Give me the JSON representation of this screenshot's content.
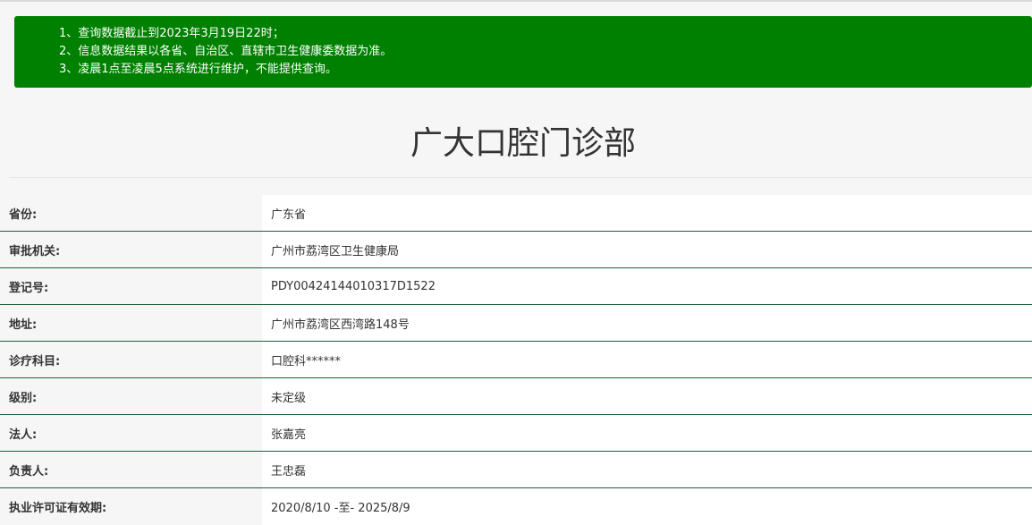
{
  "notice": {
    "lines": [
      "1、查询数据截止到2023年3月19日22时；",
      "2、信息数据结果以各省、自治区、直辖市卫生健康委数据为准。",
      "3、凌晨1点至凌晨5点系统进行维护，不能提供查询。"
    ],
    "background": "#008000"
  },
  "title": "广大口腔门诊部",
  "rows": [
    {
      "label": "省份:",
      "value": "广东省"
    },
    {
      "label": "审批机关:",
      "value": "广州市荔湾区卫生健康局"
    },
    {
      "label": "登记号:",
      "value": "PDY00424144010317D1522"
    },
    {
      "label": "地址:",
      "value": "广州市荔湾区西湾路148号"
    },
    {
      "label": "诊疗科目:",
      "value": "口腔科******"
    },
    {
      "label": "级别:",
      "value": "未定级"
    },
    {
      "label": "法人:",
      "value": "张嘉亮"
    },
    {
      "label": "负责人:",
      "value": "王忠磊"
    },
    {
      "label": "执业许可证有效期:",
      "value": "2020/8/10 -至- 2025/8/9"
    }
  ]
}
